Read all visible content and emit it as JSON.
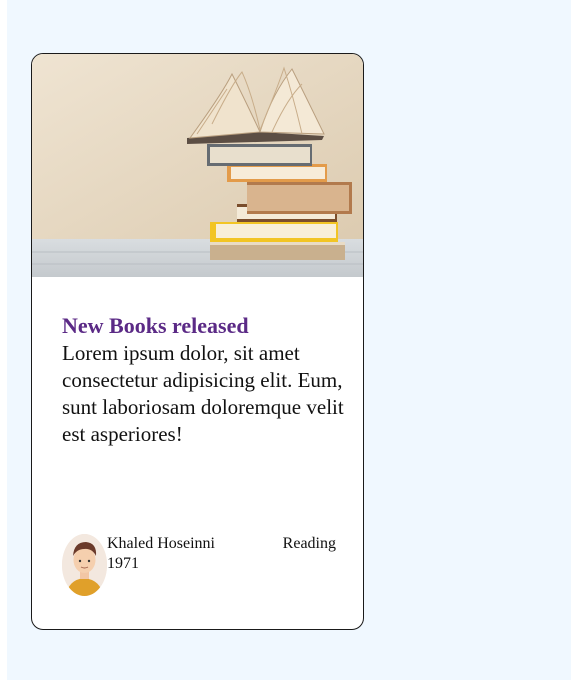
{
  "card": {
    "image_description_icon": "books-stack-image",
    "title": "New Books released",
    "body": "Lorem ipsum dolor, sit amet consectetur adipisicing elit. Eum, sunt laboriosam doloremque velit est asperiores!",
    "author": {
      "name": "Khaled Hoseinni",
      "year": "1971",
      "avatar_icon": "avatar-icon"
    },
    "status": "Reading"
  },
  "colors": {
    "page_background": "#f0f8ff",
    "title": "#5b2a86",
    "card_border": "#1a1a1a"
  }
}
